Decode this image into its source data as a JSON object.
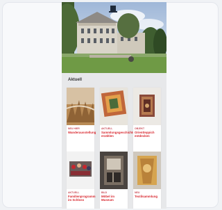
{
  "section": {
    "title": "Aktuell"
  },
  "items": [
    {
      "tag": "NEU HIER",
      "title": "Wanderausstellung"
    },
    {
      "tag": "AKTUELL",
      "title": "Sammlungsgeschichte erzählen"
    },
    {
      "tag": "OBJEKT",
      "title": "Orientteppich entdecken"
    },
    {
      "tag": "AKTUELL",
      "title": "Familienprogramm im Schloss"
    },
    {
      "tag": "BILD",
      "title": "Möbel im Museum"
    },
    {
      "tag": "NEU",
      "title": "Textilsammlung"
    }
  ],
  "colors": {
    "accent": "#d8272e",
    "background": "#e7e8ea"
  }
}
